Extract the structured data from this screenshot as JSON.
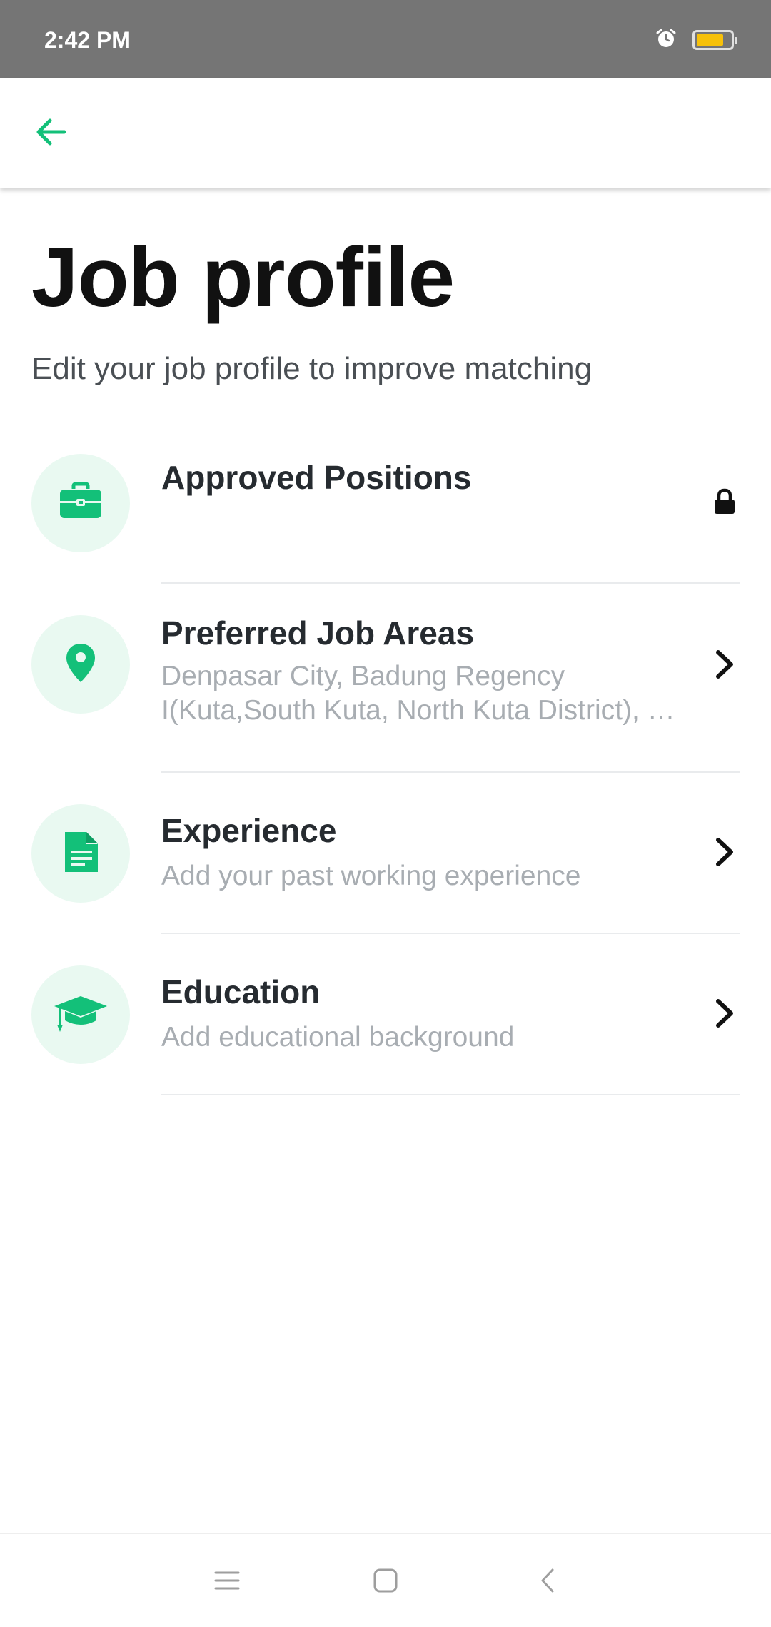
{
  "status_bar": {
    "time": "2:42 PM",
    "icons": [
      "alarm-icon",
      "battery-icon"
    ],
    "battery_level": 0.8,
    "battery_color": "#f7c10a"
  },
  "app_bar": {
    "back_icon": "arrow-left-icon",
    "accent_color": "#13c079"
  },
  "header": {
    "title": "Job profile",
    "subtitle": "Edit your job profile to improve matching"
  },
  "menu": {
    "items": [
      {
        "title": "Approved Positions",
        "description": "",
        "icon": "briefcase-icon",
        "trailing_icon": "lock-icon"
      },
      {
        "title": "Preferred Job Areas",
        "description_line1": "Denpasar City, Badung Regency",
        "description_line2": "I(Kuta,South Kuta, North Kuta District), Ba...",
        "icon": "location-pin-icon",
        "trailing_icon": "chevron-right-icon"
      },
      {
        "title": "Experience",
        "description": "Add your past working experience",
        "icon": "document-icon",
        "trailing_icon": "chevron-right-icon"
      },
      {
        "title": "Education",
        "description": "Add educational background",
        "icon": "graduation-cap-icon",
        "trailing_icon": "chevron-right-icon"
      }
    ]
  },
  "nav_bar": {
    "buttons": [
      "menu-icon",
      "home-square-icon",
      "back-chevron-icon"
    ]
  }
}
